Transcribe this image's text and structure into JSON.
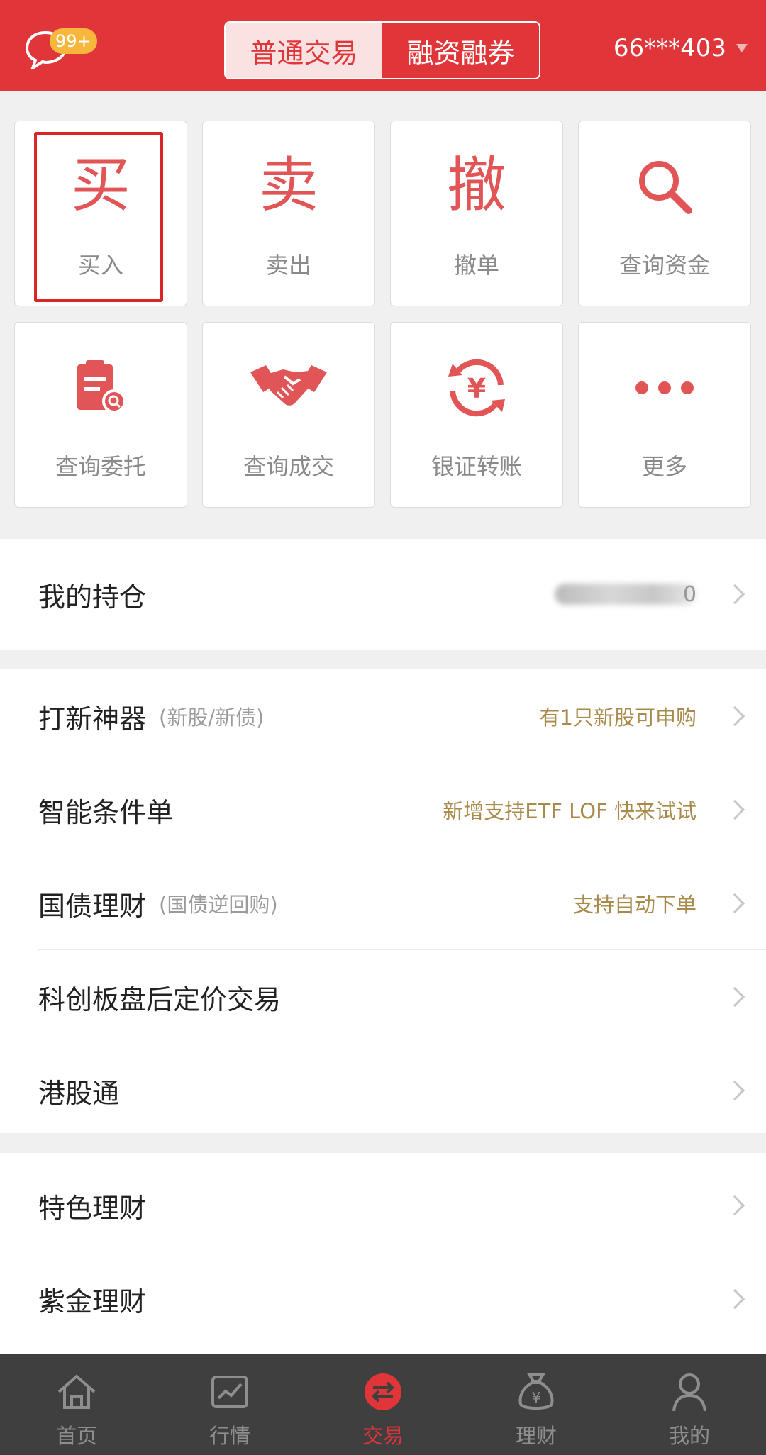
{
  "header": {
    "message_icon": "chat-bubble-icon",
    "badge": "99+",
    "tabs": [
      {
        "label": "普通交易",
        "active": true
      },
      {
        "label": "融资融券",
        "active": false
      }
    ],
    "account": "66***403"
  },
  "grid": [
    {
      "label": "买入",
      "glyph": "买",
      "highlighted": true
    },
    {
      "label": "卖出",
      "glyph": "卖"
    },
    {
      "label": "撤单",
      "glyph": "撤"
    },
    {
      "label": "查询资金",
      "icon": "search-icon"
    },
    {
      "label": "查询委托",
      "icon": "clipboard-search-icon"
    },
    {
      "label": "查询成交",
      "icon": "handshake-icon"
    },
    {
      "label": "银证转账",
      "icon": "yen-transfer-icon"
    },
    {
      "label": "更多",
      "icon": "more-dots-icon"
    }
  ],
  "positions": {
    "label": "我的持仓",
    "value_tail": "0"
  },
  "services": [
    {
      "title": "打新神器",
      "sub": "(新股/新债)",
      "hint": "有1只新股可申购"
    },
    {
      "title": "智能条件单",
      "sub": "",
      "hint": "新增支持ETF LOF 快来试试"
    },
    {
      "title": "国债理财",
      "sub": "(国债逆回购)",
      "hint": "支持自动下单"
    },
    {
      "title": "科创板盘后定价交易",
      "sub": "",
      "hint": ""
    },
    {
      "title": "港股通",
      "sub": "",
      "hint": ""
    }
  ],
  "finance": [
    {
      "title": "特色理财"
    },
    {
      "title": "紫金理财"
    }
  ],
  "tabbar": [
    {
      "label": "首页",
      "icon": "home-icon"
    },
    {
      "label": "行情",
      "icon": "market-chart-icon"
    },
    {
      "label": "交易",
      "icon": "trade-exchange-icon",
      "active": true
    },
    {
      "label": "理财",
      "icon": "money-bag-icon"
    },
    {
      "label": "我的",
      "icon": "profile-icon"
    }
  ],
  "colors": {
    "brand": "#e0363a",
    "icon": "#e25556",
    "hint": "#a88a4a",
    "tabbar": "#3f3f3f"
  }
}
